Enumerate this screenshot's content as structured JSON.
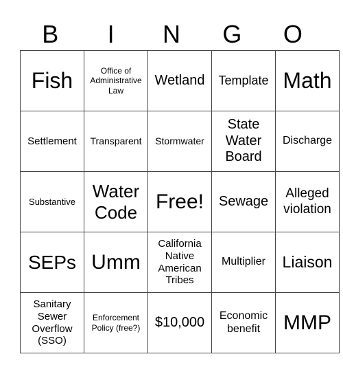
{
  "header": [
    "B",
    "I",
    "N",
    "G",
    "O"
  ],
  "rows": [
    [
      {
        "text": "Fish",
        "size": 32
      },
      {
        "text": "Office of Administrative Law",
        "size": 12
      },
      {
        "text": "Wetland",
        "size": 20
      },
      {
        "text": "Template",
        "size": 18
      },
      {
        "text": "Math",
        "size": 32
      }
    ],
    [
      {
        "text": "Settlement",
        "size": 15
      },
      {
        "text": "Transparent",
        "size": 14
      },
      {
        "text": "Stormwater",
        "size": 14
      },
      {
        "text": "State Water Board",
        "size": 20
      },
      {
        "text": "Discharge",
        "size": 16
      }
    ],
    [
      {
        "text": "Substantive",
        "size": 13
      },
      {
        "text": "Water Code",
        "size": 26
      },
      {
        "text": "Free!",
        "size": 30
      },
      {
        "text": "Sewage",
        "size": 20
      },
      {
        "text": "Alleged violation",
        "size": 19
      }
    ],
    [
      {
        "text": "SEPs",
        "size": 28
      },
      {
        "text": "Umm",
        "size": 30
      },
      {
        "text": "California Native American Tribes",
        "size": 15
      },
      {
        "text": "Multiplier",
        "size": 16
      },
      {
        "text": "Liaison",
        "size": 23
      }
    ],
    [
      {
        "text": "Sanitary Sewer Overflow (SSO)",
        "size": 15
      },
      {
        "text": "Enforcement Policy (free?)",
        "size": 12
      },
      {
        "text": "$10,000",
        "size": 20
      },
      {
        "text": "Economic benefit",
        "size": 16
      },
      {
        "text": "MMP",
        "size": 30
      }
    ]
  ]
}
